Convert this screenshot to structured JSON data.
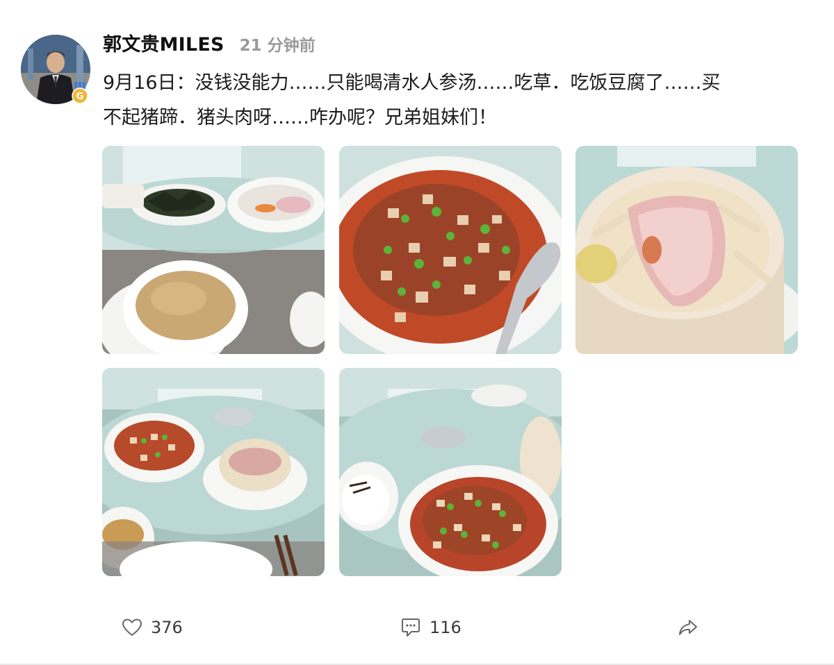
{
  "post": {
    "author": "郭文贵MILES",
    "time": "21 分钟前",
    "text_line1": "9月16日：没钱没能力……只能喝清水人参汤……吃草．吃饭豆腐了……买",
    "text_line2": "不起猪蹄．猪头肉呀……咋办呢？兄弟姐妹们！",
    "photos": [
      {
        "name": "clear-ginseng-soup-photo",
        "subject": "clear-soup-with-seaweed-and-radish-salad"
      },
      {
        "name": "mapo-tofu-photo",
        "subject": "mapo-tofu-with-spoon"
      },
      {
        "name": "steamed-fish-photo",
        "subject": "steamed-red-fish-in-bamboo-steamer"
      },
      {
        "name": "table-spread-photo",
        "subject": "table-with-tofu-fish-soup"
      },
      {
        "name": "table-tofu-rice-photo",
        "subject": "table-with-tofu-and-rice"
      }
    ]
  },
  "actions": {
    "like_icon": "heart-outline-icon",
    "like_count": "376",
    "comment_icon": "comment-bubble-icon",
    "comment_count": "116",
    "share_icon": "share-arrow-icon"
  },
  "colors": {
    "text": "#1b1b1b",
    "muted": "#9a9a9a",
    "icon": "#666666",
    "badge": "#f0b73a"
  }
}
